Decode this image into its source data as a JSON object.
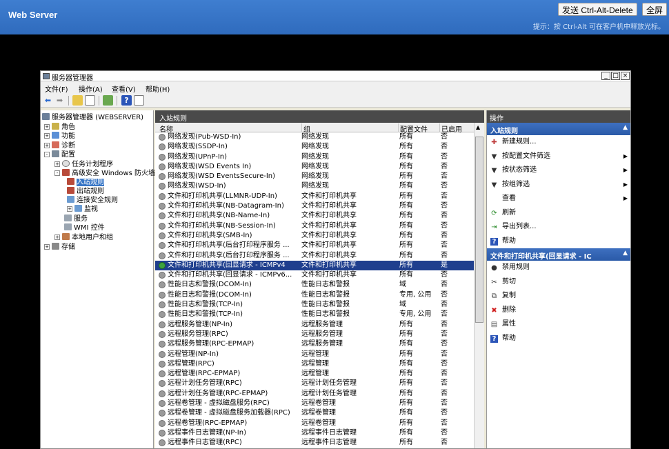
{
  "topbar": {
    "title": "Web Server",
    "cad_button": "发送 Ctrl-Alt-Delete",
    "fullscreen_button": "全屏",
    "hint": "提示：按 Ctrl-Alt 可在客户机中释放光标。"
  },
  "window": {
    "title": "服务器管理器",
    "controls": {
      "min": "_",
      "restore": "□",
      "close": "×"
    }
  },
  "menu": [
    "文件(F)",
    "操作(A)",
    "查看(V)",
    "帮助(H)"
  ],
  "tree": {
    "root": "服务器管理器 (WEBSERVER)",
    "roles": "角色",
    "features": "功能",
    "diagnostics": "诊断",
    "configuration": "配置",
    "task_scheduler": "任务计划程序",
    "firewall": "高级安全 Windows 防火墙",
    "inbound": "入站规则",
    "outbound": "出站规则",
    "connection_security": "连接安全规则",
    "monitoring": "监视",
    "services": "服务",
    "wmi": "WMI 控件",
    "local_users": "本地用户和组",
    "storage": "存储"
  },
  "center": {
    "header": "入站规则",
    "columns": {
      "name": "名称",
      "group": "组",
      "profile": "配置文件",
      "enabled": "已启用"
    },
    "rows": [
      {
        "name": "网络发现(Pub-WSD-In)",
        "group": "网络发现",
        "profile": "所有",
        "enabled": "否"
      },
      {
        "name": "网络发现(SSDP-In)",
        "group": "网络发现",
        "profile": "所有",
        "enabled": "否"
      },
      {
        "name": "网络发现(UPnP-In)",
        "group": "网络发现",
        "profile": "所有",
        "enabled": "否"
      },
      {
        "name": "网络发现(WSD Events In)",
        "group": "网络发现",
        "profile": "所有",
        "enabled": "否"
      },
      {
        "name": "网络发现(WSD EventsSecure-In)",
        "group": "网络发现",
        "profile": "所有",
        "enabled": "否"
      },
      {
        "name": "网络发现(WSD-In)",
        "group": "网络发现",
        "profile": "所有",
        "enabled": "否"
      },
      {
        "name": "文件和打印机共享(LLMNR-UDP-In)",
        "group": "文件和打印机共享",
        "profile": "所有",
        "enabled": "否"
      },
      {
        "name": "文件和打印机共享(NB-Datagram-In)",
        "group": "文件和打印机共享",
        "profile": "所有",
        "enabled": "否"
      },
      {
        "name": "文件和打印机共享(NB-Name-In)",
        "group": "文件和打印机共享",
        "profile": "所有",
        "enabled": "否"
      },
      {
        "name": "文件和打印机共享(NB-Session-In)",
        "group": "文件和打印机共享",
        "profile": "所有",
        "enabled": "否"
      },
      {
        "name": "文件和打印机共享(SMB-In)",
        "group": "文件和打印机共享",
        "profile": "所有",
        "enabled": "否"
      },
      {
        "name": "文件和打印机共享(后台打印程序服务 ...",
        "group": "文件和打印机共享",
        "profile": "所有",
        "enabled": "否"
      },
      {
        "name": "文件和打印机共享(后台打印程序服务 ...",
        "group": "文件和打印机共享",
        "profile": "所有",
        "enabled": "否"
      },
      {
        "name": "文件和打印机共享(回显请求 - ICMPv4",
        "group": "文件和打印机共享",
        "profile": "所有",
        "enabled": "是",
        "selected": true
      },
      {
        "name": "文件和打印机共享(回显请求 - ICMPv6...",
        "group": "文件和打印机共享",
        "profile": "所有",
        "enabled": "否"
      },
      {
        "name": "性能日志和警报(DCOM-In)",
        "group": "性能日志和警报",
        "profile": "域",
        "enabled": "否"
      },
      {
        "name": "性能日志和警报(DCOM-In)",
        "group": "性能日志和警报",
        "profile": "专用, 公用",
        "enabled": "否"
      },
      {
        "name": "性能日志和警报(TCP-In)",
        "group": "性能日志和警报",
        "profile": "域",
        "enabled": "否"
      },
      {
        "name": "性能日志和警报(TCP-In)",
        "group": "性能日志和警报",
        "profile": "专用, 公用",
        "enabled": "否"
      },
      {
        "name": "远程服务管理(NP-In)",
        "group": "远程服务管理",
        "profile": "所有",
        "enabled": "否"
      },
      {
        "name": "远程服务管理(RPC)",
        "group": "远程服务管理",
        "profile": "所有",
        "enabled": "否"
      },
      {
        "name": "远程服务管理(RPC-EPMAP)",
        "group": "远程服务管理",
        "profile": "所有",
        "enabled": "否"
      },
      {
        "name": "远程管理(NP-In)",
        "group": "远程管理",
        "profile": "所有",
        "enabled": "否"
      },
      {
        "name": "远程管理(RPC)",
        "group": "远程管理",
        "profile": "所有",
        "enabled": "否"
      },
      {
        "name": "远程管理(RPC-EPMAP)",
        "group": "远程管理",
        "profile": "所有",
        "enabled": "否"
      },
      {
        "name": "远程计划任务管理(RPC)",
        "group": "远程计划任务管理",
        "profile": "所有",
        "enabled": "否"
      },
      {
        "name": "远程计划任务管理(RPC-EPMAP)",
        "group": "远程计划任务管理",
        "profile": "所有",
        "enabled": "否"
      },
      {
        "name": "远程卷管理 - 虚拟磁盘服务(RPC)",
        "group": "远程卷管理",
        "profile": "所有",
        "enabled": "否"
      },
      {
        "name": "远程卷管理 - 虚拟磁盘服务加载器(RPC)",
        "group": "远程卷管理",
        "profile": "所有",
        "enabled": "否"
      },
      {
        "name": "远程卷管理(RPC-EPMAP)",
        "group": "远程卷管理",
        "profile": "所有",
        "enabled": "否"
      },
      {
        "name": "远程事件日志管理(NP-In)",
        "group": "远程事件日志管理",
        "profile": "所有",
        "enabled": "否"
      },
      {
        "name": "远程事件日志管理(RPC)",
        "group": "远程事件日志管理",
        "profile": "所有",
        "enabled": "否"
      }
    ]
  },
  "actions": {
    "header": "操作",
    "section1": {
      "title": "入站规则",
      "items": [
        {
          "label": "新建规则...",
          "icon": "new-rule-icon",
          "arrow": false
        },
        {
          "label": "按配置文件筛选",
          "icon": "filter-icon",
          "arrow": true
        },
        {
          "label": "按状态筛选",
          "icon": "filter-icon",
          "arrow": true
        },
        {
          "label": "按组筛选",
          "icon": "filter-icon",
          "arrow": true
        },
        {
          "label": "查看",
          "icon": "",
          "arrow": true
        },
        {
          "label": "刷新",
          "icon": "refresh-icon",
          "arrow": false
        },
        {
          "label": "导出列表...",
          "icon": "export-icon",
          "arrow": false
        },
        {
          "label": "帮助",
          "icon": "help-icon",
          "arrow": false
        }
      ]
    },
    "section2": {
      "title": "文件和打印机共享(回显请求 - IC",
      "items": [
        {
          "label": "禁用规则",
          "icon": "disable-icon"
        },
        {
          "label": "剪切",
          "icon": "cut-icon"
        },
        {
          "label": "复制",
          "icon": "copy-icon"
        },
        {
          "label": "删除",
          "icon": "delete-icon"
        },
        {
          "label": "属性",
          "icon": "properties-icon"
        },
        {
          "label": "帮助",
          "icon": "help-icon"
        }
      ]
    }
  },
  "colors": {
    "accent": "#3e70c0",
    "selected_row": "#1f3f8e",
    "header_dark": "#4a4a4a",
    "topbar": "#3f7ed0"
  }
}
